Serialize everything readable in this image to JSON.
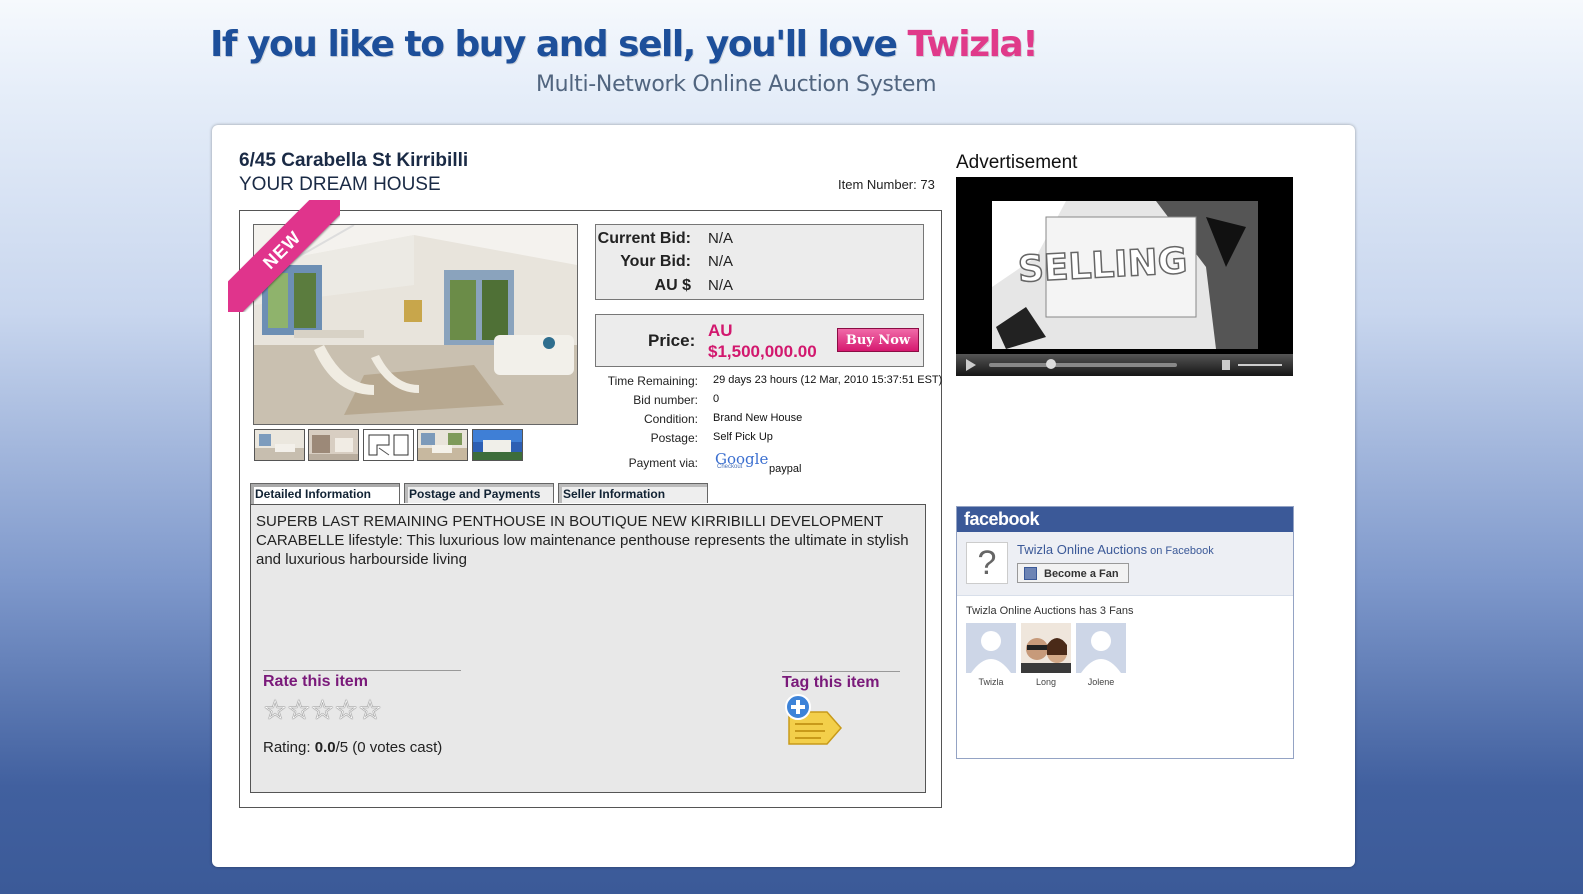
{
  "header": {
    "tagline": "If you like to buy and sell, you'll love ",
    "brand": "Twizla!",
    "subtitle": "Multi-Network Online Auction System"
  },
  "item": {
    "title": "6/45 Carabella St Kirribilli",
    "subtitle": "YOUR DREAM HOUSE",
    "number_label": "Item Number: 73",
    "ribbon": "NEW"
  },
  "bid": {
    "current_label": "Current Bid:",
    "current_value": "N/A",
    "your_label": "Your Bid:",
    "your_value": "N/A",
    "currency_label": "AU $",
    "currency_value": "N/A"
  },
  "price": {
    "label": "Price:",
    "currency": "AU",
    "amount": "$1,500,000.00",
    "buy_now": "Buy Now"
  },
  "info": {
    "time_label": "Time Remaining:",
    "time_value": "29 days 23 hours (12 Mar, 2010 15:37:51 EST)",
    "bids_label": "Bid number:",
    "bids_value": "0",
    "condition_label": "Condition:",
    "condition_value": "Brand New House",
    "postage_label": "Postage:",
    "postage_value": "Self Pick Up",
    "payment_label": "Payment via:",
    "google_logo": "Google",
    "google_sub": "Checkout",
    "paypal": "paypal"
  },
  "tabs": [
    {
      "label": "Detailed Information"
    },
    {
      "label": "Postage and Payments"
    },
    {
      "label": "Seller Information"
    }
  ],
  "description": "SUPERB LAST REMAINING PENTHOUSE IN BOUTIQUE NEW KIRRIBILLI DEVELOPMENT CARABELLE lifestyle: This luxurious low maintenance penthouse represents the ultimate in stylish and luxurious harbourside living",
  "rating": {
    "title": "Rate this item",
    "stars": "☆☆☆☆☆",
    "max_stars": 5,
    "prefix": "Rating: ",
    "score": "0.0",
    "suffix": "/5 (0 votes cast)"
  },
  "tag": {
    "title": "Tag this item",
    "icon": "tag-add-icon"
  },
  "ad": {
    "label": "Advertisement",
    "video_text": "SELLING"
  },
  "facebook": {
    "header": "facebook",
    "page_name": "Twizla Online Auctions",
    "on_facebook": " on Facebook",
    "fan_button": "Become a Fan",
    "fan_count": "Twizla Online Auctions has 3 Fans",
    "fans": [
      {
        "name": "Twizla"
      },
      {
        "name": "Long"
      },
      {
        "name": "Jolene"
      }
    ]
  },
  "colors": {
    "brand_pink": "#e03a8a",
    "title_blue": "#1d4f9a",
    "price_pink": "#d2186e",
    "facebook_blue": "#3b5998",
    "rating_purple": "#7a1a7a"
  }
}
